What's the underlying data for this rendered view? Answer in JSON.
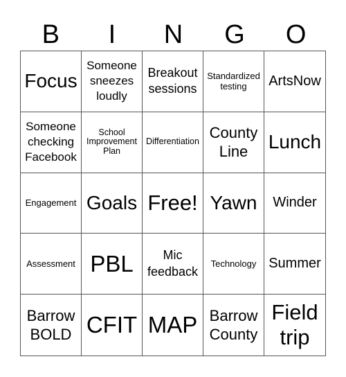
{
  "header": {
    "letters": [
      "B",
      "I",
      "N",
      "G",
      "O"
    ]
  },
  "cells": [
    "Focus",
    "Someone sneezes loudly",
    "Breakout sessions",
    "Standardized testing",
    "ArtsNow",
    "Someone checking Facebook",
    "School Improvement Plan",
    "Differentiation",
    "County Line",
    "Lunch",
    "Engagement",
    "Goals",
    "Free!",
    "Yawn",
    "Winder",
    "Assessment",
    "PBL",
    "Mic feedback",
    "Technology",
    "Summer",
    "Barrow BOLD",
    "CFIT",
    "MAP",
    "Barrow County",
    "Field trip"
  ]
}
